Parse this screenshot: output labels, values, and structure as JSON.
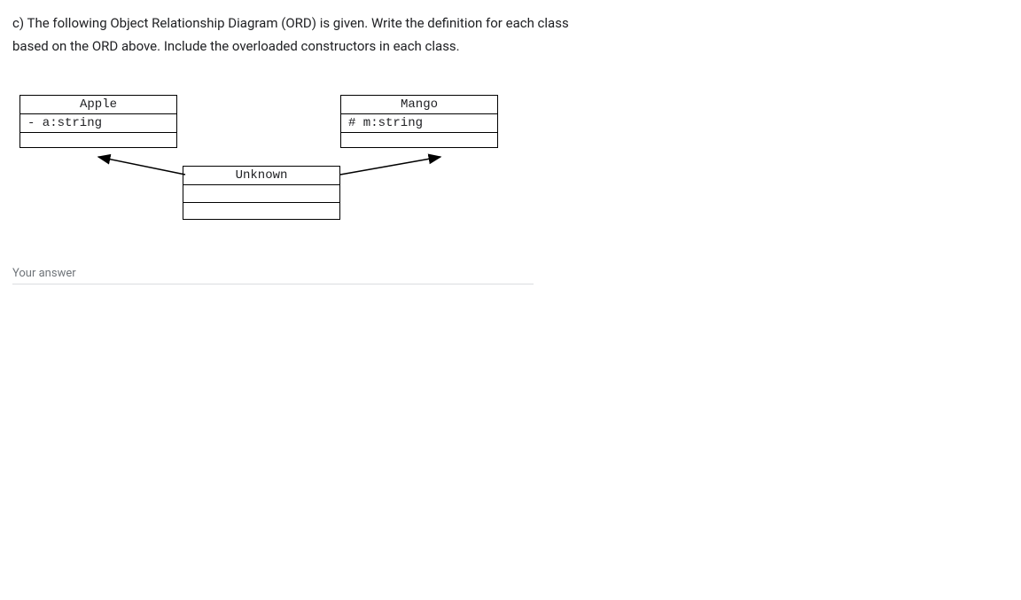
{
  "question": {
    "text": "c) The following Object Relationship Diagram (ORD) is given. Write the definition for each class based on the ORD above. Include the overloaded constructors in each class."
  },
  "uml": {
    "apple": {
      "name": "Apple",
      "attribute": "- a:string"
    },
    "mango": {
      "name": "Mango",
      "attribute": "# m:string"
    },
    "unknown": {
      "name": "Unknown",
      "attribute": ""
    }
  },
  "answer": {
    "placeholder": "Your answer"
  }
}
